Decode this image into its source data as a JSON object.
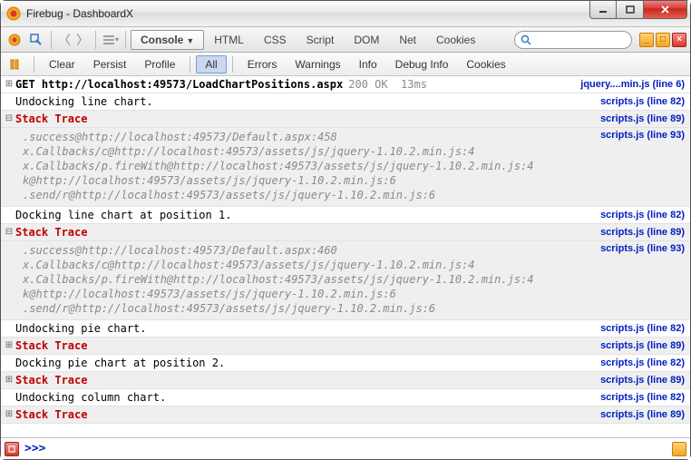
{
  "window": {
    "title": "Firebug - DashboardX"
  },
  "toolbar": {
    "tabs": [
      "Console",
      "HTML",
      "CSS",
      "Script",
      "DOM",
      "Net",
      "Cookies"
    ],
    "active_tab": 0,
    "search_placeholder": ""
  },
  "subtoolbar": {
    "items": [
      "Clear",
      "Persist",
      "Profile",
      "All",
      "Errors",
      "Warnings",
      "Info",
      "Debug Info",
      "Cookies"
    ],
    "active": "All"
  },
  "log": [
    {
      "type": "http",
      "expand": "plus",
      "method": "GET",
      "url": "http://localhost:49573/LoadChartPositions.aspx",
      "status": "200 OK",
      "time": "13ms",
      "src": "jquery....min.js (line 6)"
    },
    {
      "type": "msg",
      "text": "Undocking line chart.",
      "src": "scripts.js (line 82)"
    },
    {
      "type": "stack",
      "expand": "minus",
      "src": "scripts.js (line 89)",
      "trace_src": "scripts.js (line 93)",
      "lines": [
        ".success@http://localhost:49573/Default.aspx:458",
        "x.Callbacks/c@http://localhost:49573/assets/js/jquery-1.10.2.min.js:4",
        "x.Callbacks/p.fireWith@http://localhost:49573/assets/js/jquery-1.10.2.min.js:4",
        "k@http://localhost:49573/assets/js/jquery-1.10.2.min.js:6",
        ".send/r@http://localhost:49573/assets/js/jquery-1.10.2.min.js:6"
      ]
    },
    {
      "type": "msg",
      "text": "Docking line chart at position 1.",
      "src": "scripts.js (line 82)"
    },
    {
      "type": "stack",
      "expand": "minus",
      "src": "scripts.js (line 89)",
      "trace_src": "scripts.js (line 93)",
      "lines": [
        ".success@http://localhost:49573/Default.aspx:460",
        "x.Callbacks/c@http://localhost:49573/assets/js/jquery-1.10.2.min.js:4",
        "x.Callbacks/p.fireWith@http://localhost:49573/assets/js/jquery-1.10.2.min.js:4",
        "k@http://localhost:49573/assets/js/jquery-1.10.2.min.js:6",
        ".send/r@http://localhost:49573/assets/js/jquery-1.10.2.min.js:6"
      ]
    },
    {
      "type": "msg",
      "text": "Undocking pie chart.",
      "src": "scripts.js (line 82)"
    },
    {
      "type": "stack",
      "expand": "plus",
      "src": "scripts.js (line 89)"
    },
    {
      "type": "msg",
      "text": "Docking pie chart at position 2.",
      "src": "scripts.js (line 82)"
    },
    {
      "type": "stack",
      "expand": "plus",
      "src": "scripts.js (line 89)"
    },
    {
      "type": "msg",
      "text": "Undocking column chart.",
      "src": "scripts.js (line 82)"
    },
    {
      "type": "stack",
      "expand": "plus",
      "src": "scripts.js (line 89)"
    }
  ],
  "cmdline": {
    "prompt": ">>>"
  },
  "stack_label": "Stack Trace"
}
